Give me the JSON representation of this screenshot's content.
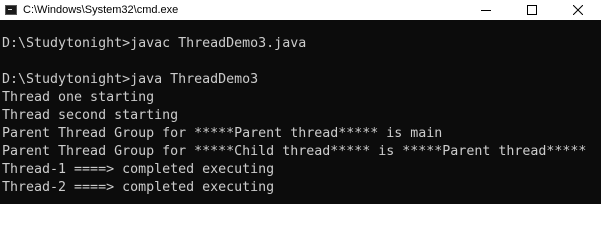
{
  "window": {
    "title": "C:\\Windows\\System32\\cmd.exe",
    "icon": "console-app-icon",
    "controls": [
      "minimize-icon",
      "maximize-icon",
      "close-icon"
    ]
  },
  "console": {
    "lines": [
      "",
      "D:\\Studytonight>javac ThreadDemo3.java",
      "",
      "D:\\Studytonight>java ThreadDemo3",
      "Thread one starting",
      "Thread second starting",
      "Parent Thread Group for *****Parent thread***** is main",
      "Parent Thread Group for *****Child thread***** is *****Parent thread*****",
      "Thread-1 ====> completed executing",
      "Thread-2 ====> completed executing"
    ],
    "background": "#0c0c0c",
    "foreground": "#cccccc"
  }
}
